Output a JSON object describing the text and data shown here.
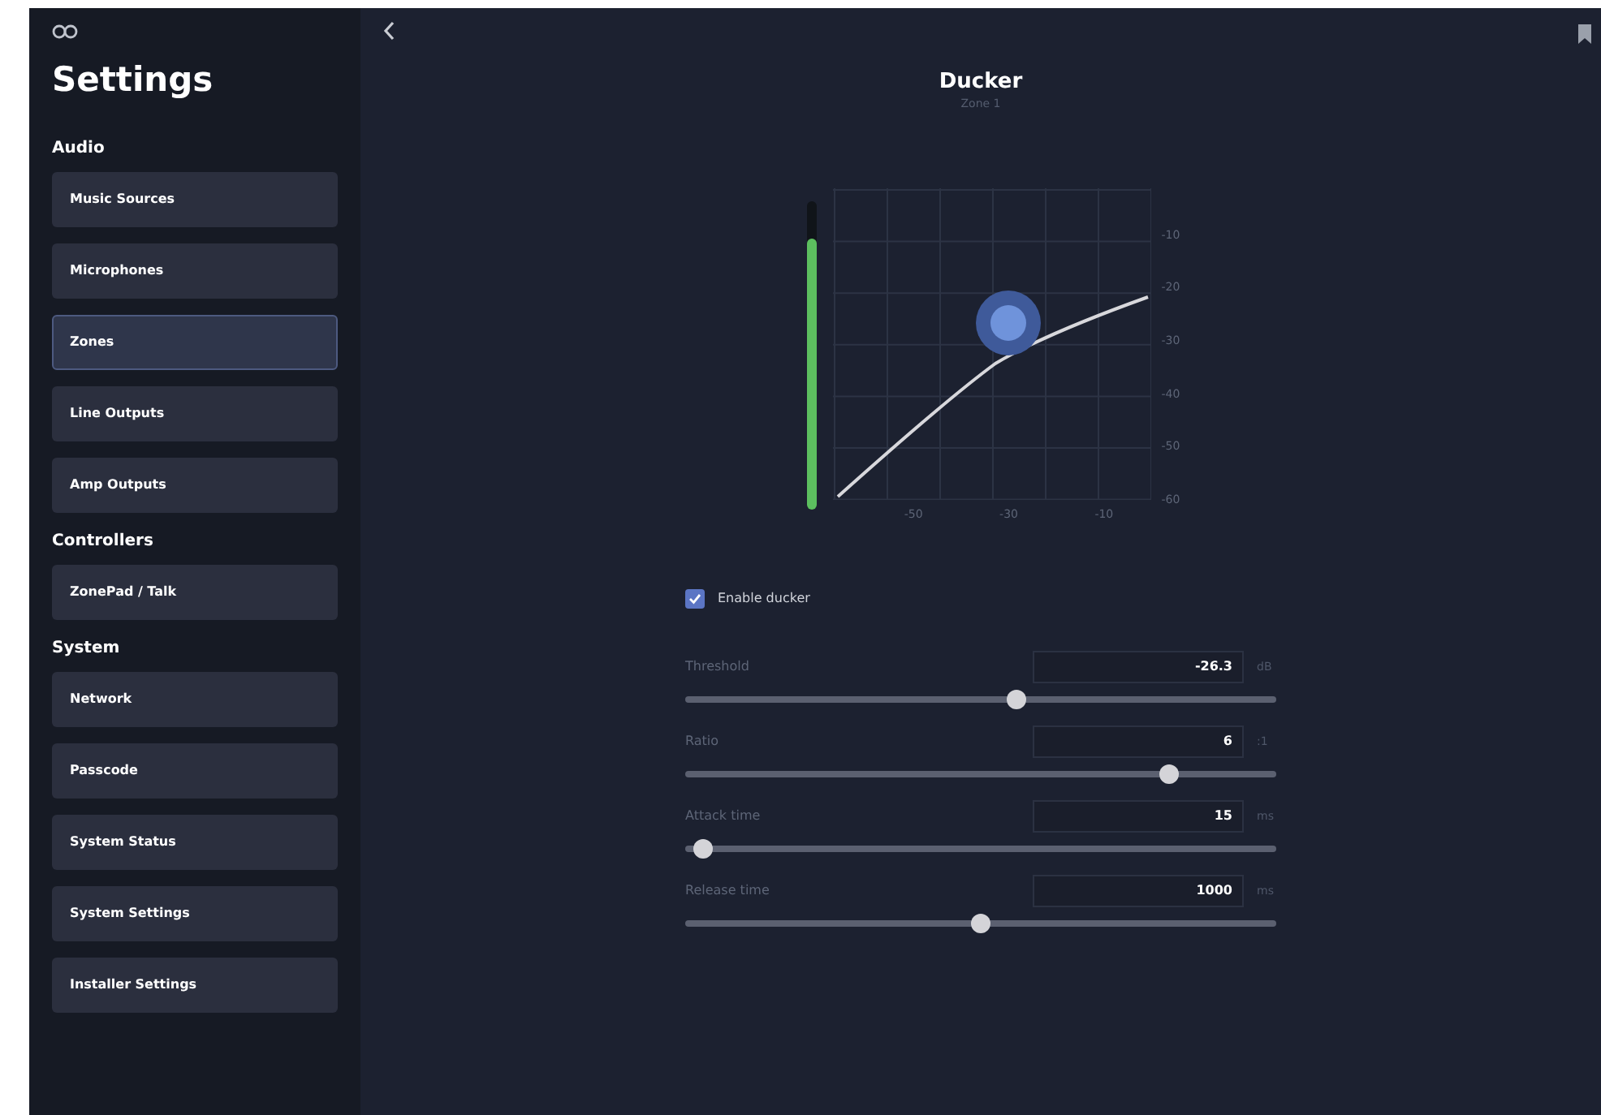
{
  "sidebar": {
    "title": "Settings",
    "sections": [
      {
        "heading": "Audio",
        "items": [
          {
            "label": "Music Sources",
            "selected": false
          },
          {
            "label": "Microphones",
            "selected": false
          },
          {
            "label": "Zones",
            "selected": true
          },
          {
            "label": "Line Outputs",
            "selected": false
          },
          {
            "label": "Amp Outputs",
            "selected": false
          }
        ]
      },
      {
        "heading": "Controllers",
        "items": [
          {
            "label": "ZonePad / Talk",
            "selected": false
          }
        ]
      },
      {
        "heading": "System",
        "items": [
          {
            "label": "Network",
            "selected": false
          },
          {
            "label": "Passcode",
            "selected": false
          },
          {
            "label": "System Status",
            "selected": false
          },
          {
            "label": "System Settings",
            "selected": false
          },
          {
            "label": "Installer Settings",
            "selected": false
          }
        ]
      }
    ]
  },
  "header": {
    "title": "Ducker",
    "subtitle": "Zone 1"
  },
  "graph": {
    "meter": {
      "level": 0.88
    },
    "y_labels": [
      "-10",
      "-20",
      "-30",
      "-40",
      "-50",
      "-60"
    ],
    "x_labels": [
      "-50",
      "-30",
      "-10"
    ]
  },
  "enable": {
    "label": "Enable ducker",
    "checked": true
  },
  "controls": [
    {
      "label": "Threshold",
      "value": "-26.3",
      "unit": "dB",
      "level": 0.56
    },
    {
      "label": "Ratio",
      "value": "6",
      "unit": ":1",
      "level": 0.82
    },
    {
      "label": "Attack time",
      "value": "15",
      "unit": "ms",
      "level": 0.03
    },
    {
      "label": "Release time",
      "value": "1000",
      "unit": "ms",
      "level": 0.5
    }
  ]
}
